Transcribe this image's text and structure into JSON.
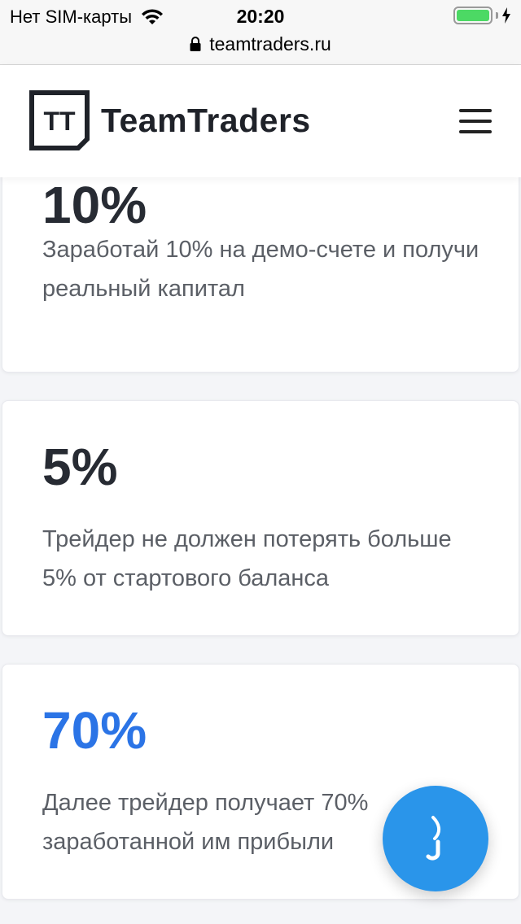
{
  "status_bar": {
    "carrier": "Нет SIM-карты",
    "time": "20:20",
    "battery_level": 1.0,
    "battery_color": "#4cd964"
  },
  "address_bar": {
    "url": "teamtraders.ru",
    "icon": "lock-icon"
  },
  "header": {
    "logo_mark": "TT",
    "logo_text": "TeamTraders",
    "menu_icon": "hamburger-menu-icon"
  },
  "cards": [
    {
      "number": "10%",
      "text": "Заработай 10% на демо-счете и получи реальный капитал"
    },
    {
      "number": "5%",
      "text": "Трейдер не должен потерять больше 5% от стартового баланса"
    },
    {
      "number": "70%",
      "text": "Далее трейдер получает 70% заработанной им прибыли",
      "accent_color": "#2b74e6"
    }
  ],
  "chat_button": {
    "icon": "chat-icon",
    "color": "#2a95ea"
  }
}
